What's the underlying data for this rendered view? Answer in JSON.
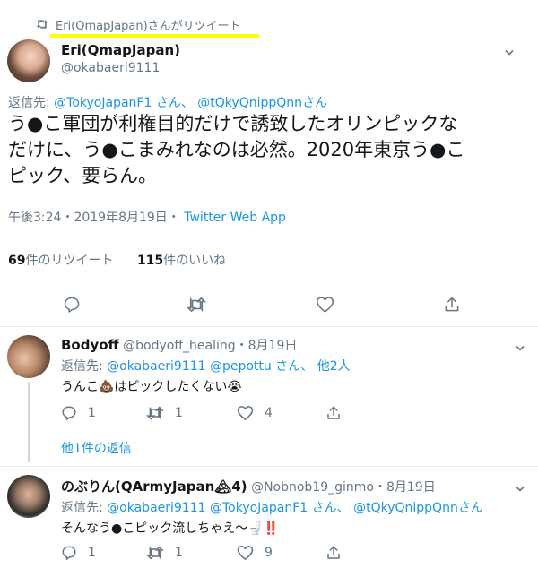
{
  "retweet_banner": {
    "icon": "retweet-icon",
    "text": "Eri(QmapJapan)さんがリツイート",
    "highlight_color": "#ffff00"
  },
  "main_tweet": {
    "display_name": "Eri(QmapJapan)",
    "handle": "@okabaeri9111",
    "reply_prefix": "返信先:",
    "reply_user_1": "@TokyoJapanF1",
    "reply_san_1": "さん、",
    "reply_user_2": "@tQkyQnippQnn",
    "reply_san_2": "さん",
    "text_line1": "う●こ軍団が利権目的だけで誘致したオリンピックな",
    "text_line2": "だけに、う●こまみれなのは必然。2020年東京う●こ",
    "text_line3": "ピック、要らん。",
    "timestamp": "午後3:24・2019年8月19日・",
    "source": "Twitter Web App",
    "retweet_count": "69",
    "retweet_label": "件のリツイート",
    "like_count": "115",
    "like_label": "件のいいね"
  },
  "reply1": {
    "display_name": "Bodyoff",
    "handle": "@bodyoff_healing",
    "date": "・8月19日",
    "reply_prefix": "返信先:",
    "reply_users": "@okabaeri9111 @pepottu",
    "reply_suffix": "さん、",
    "reply_others": "他2人",
    "text": "うんこ💩はピックしたくない😭",
    "reply_count": "1",
    "retweet_count": "1",
    "like_count": "4"
  },
  "more_replies": "他1件の返信",
  "reply2": {
    "display_name": "のぶりん(QArmyJapan🏔4)",
    "handle": "@Nobnob19_ginmo",
    "date": "・8月19日",
    "reply_prefix": "返信先:",
    "reply_users": "@okabaeri9111 @TokyoJapanF1",
    "reply_san_1": "さん、",
    "reply_user_3": "@tQkyQnippQnn",
    "reply_san_2": "さん",
    "text": "そんなう●こピック流しちゃえ〜🚽‼️",
    "reply_count": "1",
    "retweet_count": "1",
    "like_count": "9"
  },
  "colors": {
    "link": "#1b95e0",
    "muted": "#657786",
    "text": "#14171a",
    "border": "#e6ecf0"
  }
}
